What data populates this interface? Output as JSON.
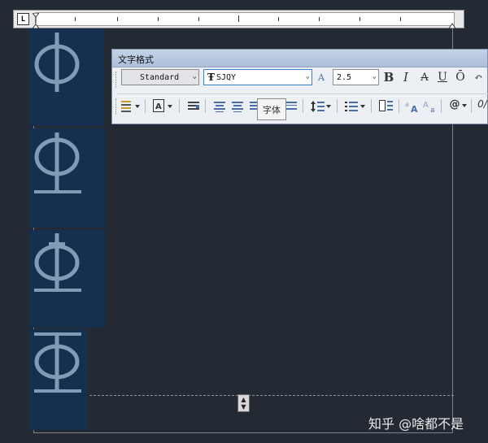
{
  "ruler": {
    "tab_button": "L"
  },
  "toolbar": {
    "title": "文字格式",
    "style_value": "Standard",
    "font_icon": "Ŧ",
    "font_value": "SJQY",
    "annotative_icon": "A",
    "height_value": "2.5",
    "bold": "B",
    "italic": "I",
    "strike": "A",
    "underline": "U",
    "overline": "Ō",
    "undo": "↶",
    "at_symbol": "@",
    "oblique": "0/"
  },
  "tooltip": {
    "text": "字体"
  },
  "resize_handle": {
    "up": "▲",
    "down": "▼"
  },
  "watermark": "知乎 @啥都不是",
  "colors": {
    "background": "#242a33",
    "cell": "#15304f",
    "glyph": "#7f9bb5"
  }
}
